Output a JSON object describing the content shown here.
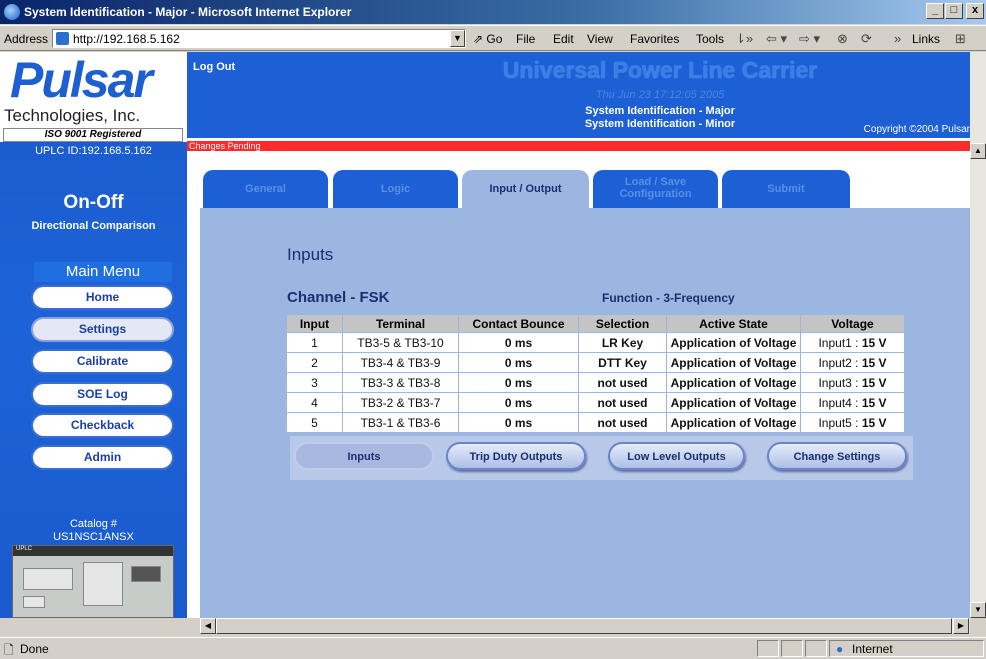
{
  "window": {
    "title": "System Identification - Major - Microsoft Internet Explorer",
    "buttons": {
      "minimize": "_",
      "maximize": "□",
      "close": "x"
    }
  },
  "addressbar": {
    "label": "Address",
    "url": "http://192.168.5.162",
    "go": "Go",
    "menu": [
      "File",
      "Edit",
      "View",
      "Favorites",
      "Tools"
    ],
    "links": "Links"
  },
  "sidebar": {
    "brand": "Pulsar",
    "company": "Technologies, Inc.",
    "iso": "ISO 9001 Registered",
    "uplc_id": "UPLC ID:192.168.5.162",
    "mode": "On-Off",
    "scheme": "Directional Comparison",
    "menu_title": "Main Menu",
    "menu": [
      {
        "label": "Home"
      },
      {
        "label": "Settings"
      },
      {
        "label": "Calibrate"
      },
      {
        "label": "SOE Log"
      },
      {
        "label": "Checkback"
      },
      {
        "label": "Admin"
      }
    ],
    "catalog_label": "Catalog #",
    "catalog_number": "US1NSC1ANSX",
    "device_label": "UPLC"
  },
  "header": {
    "logout": "Log Out",
    "product": "Universal Power Line Carrier",
    "datetime": "Thu Jun 23 17:12:05 2005",
    "sysid_major": "System Identification - Major",
    "sysid_minor": "System Identification - Minor",
    "copyright": "Copyright ©2004 Pulsar",
    "pending": "Changes Pending"
  },
  "tabs": [
    {
      "label": "General"
    },
    {
      "label": "Logic"
    },
    {
      "label": "Input / Output"
    },
    {
      "label": "Load / Save",
      "label2": "Configuration"
    },
    {
      "label": "Submit"
    }
  ],
  "main": {
    "section": "Inputs",
    "channel": "Channel - FSK",
    "function": "Function - 3-Frequency",
    "columns": [
      "Input",
      "Terminal",
      "Contact Bounce",
      "Selection",
      "Active State",
      "Voltage"
    ],
    "rows": [
      {
        "input": "1",
        "terminal": "TB3-5 & TB3-10",
        "bounce": "0 ms",
        "selection": "LR Key",
        "state": "Application of Voltage",
        "vname": "Input1 :",
        "volt": "15 V"
      },
      {
        "input": "2",
        "terminal": "TB3-4 & TB3-9",
        "bounce": "0 ms",
        "selection": "DTT Key",
        "state": "Application of Voltage",
        "vname": "Input2 :",
        "volt": "15 V"
      },
      {
        "input": "3",
        "terminal": "TB3-3 & TB3-8",
        "bounce": "0 ms",
        "selection": "not used",
        "state": "Application of Voltage",
        "vname": "Input3 :",
        "volt": "15 V"
      },
      {
        "input": "4",
        "terminal": "TB3-2 & TB3-7",
        "bounce": "0 ms",
        "selection": "not used",
        "state": "Application of Voltage",
        "vname": "Input4 :",
        "volt": "15 V"
      },
      {
        "input": "5",
        "terminal": "TB3-1 & TB3-6",
        "bounce": "0 ms",
        "selection": "not used",
        "state": "Application of Voltage",
        "vname": "Input5 :",
        "volt": "15 V"
      }
    ],
    "subtabs": [
      {
        "label": "Inputs"
      },
      {
        "label": "Trip Duty Outputs"
      },
      {
        "label": "Low Level Outputs"
      },
      {
        "label": "Change Settings"
      }
    ]
  },
  "status": {
    "text": "Done",
    "zone": "Internet"
  },
  "colors": {
    "brand_blue": "#1d5fd5",
    "content_bg": "#9bb6e0",
    "pending_red": "#ff2a2a"
  }
}
